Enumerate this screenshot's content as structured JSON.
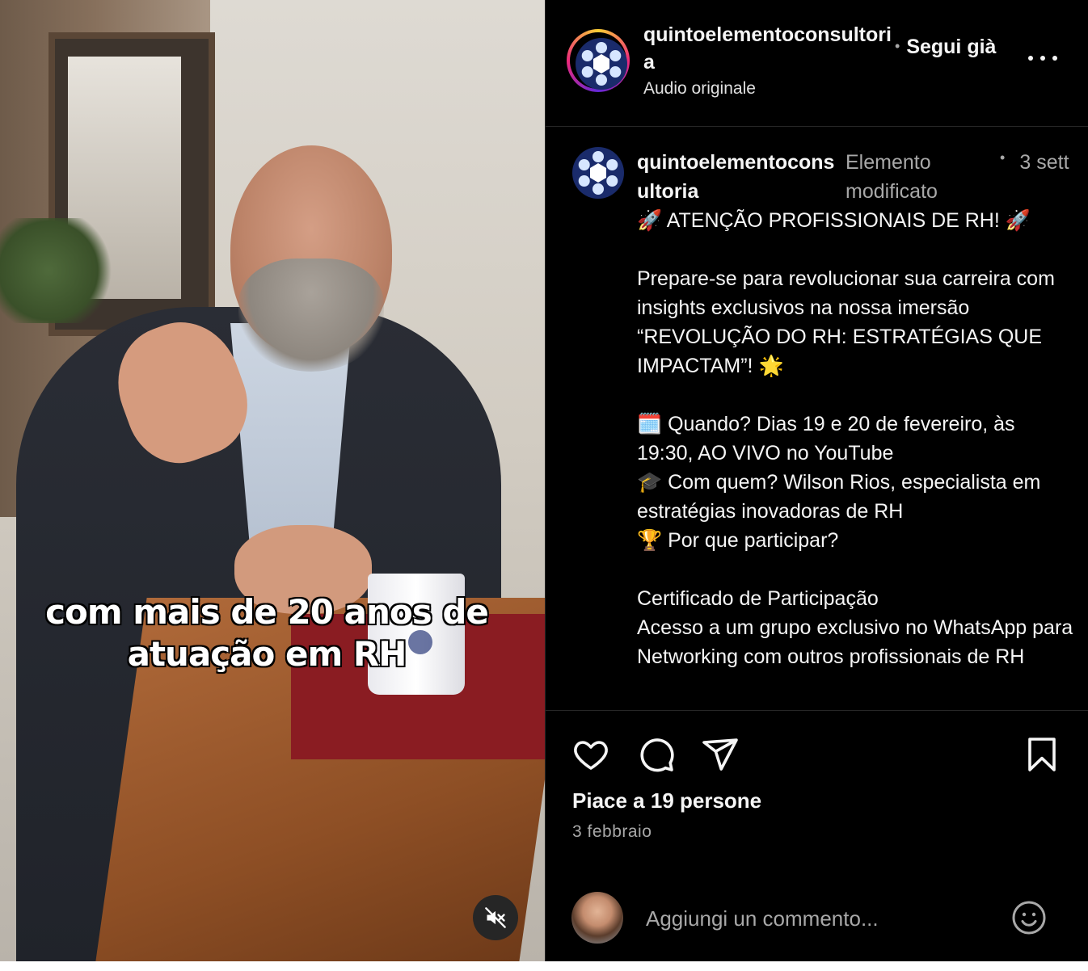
{
  "video": {
    "caption_line1": "com mais de 20 anos de",
    "caption_line2": "atuação em RH",
    "mute_icon": "speaker-muted-icon"
  },
  "header": {
    "username": "quintoelementoconsultoria",
    "audio": "Audio originale",
    "follow_label": "Segui già",
    "separator": "•",
    "more_icon": "more-horizontal-icon"
  },
  "post": {
    "username": "quintoelementoconsultoria",
    "edited_label": "Elemento modificato",
    "separator": "•",
    "time": "3 sett",
    "lines": [
      "🚀 ATENÇÃO PROFISSIONAIS DE RH! 🚀",
      "",
      "Prepare-se para revolucionar sua carreira com insights exclusivos na nossa imersão “REVOLUÇÃO DO RH: ESTRATÉGIAS QUE IMPACTAM”! 🌟",
      "",
      "🗓️ Quando? Dias 19 e 20 de fevereiro, às 19:30, AO VIVO no YouTube",
      "🎓 Com quem? Wilson Rios, especialista em estratégias inovadoras de RH",
      "🏆 Por que participar?",
      "",
      "Certificado de Participação",
      "Acesso a um grupo exclusivo no WhatsApp para Networking com outros profissionais de RH"
    ]
  },
  "actions": {
    "like_icon": "heart-icon",
    "comment_icon": "comment-bubble-icon",
    "share_icon": "paper-plane-icon",
    "save_icon": "bookmark-icon",
    "likes": "Piace a 19 persone",
    "date": "3 febbraio"
  },
  "comment": {
    "placeholder": "Aggiungi un commento...",
    "emoji_icon": "emoji-smile-icon"
  },
  "colors": {
    "panel_background": "#000000",
    "primary_text": "#f5f5f5",
    "secondary_text": "#a8a8a8",
    "divider": "#262626",
    "logo_blue": "#1a2b6b"
  }
}
